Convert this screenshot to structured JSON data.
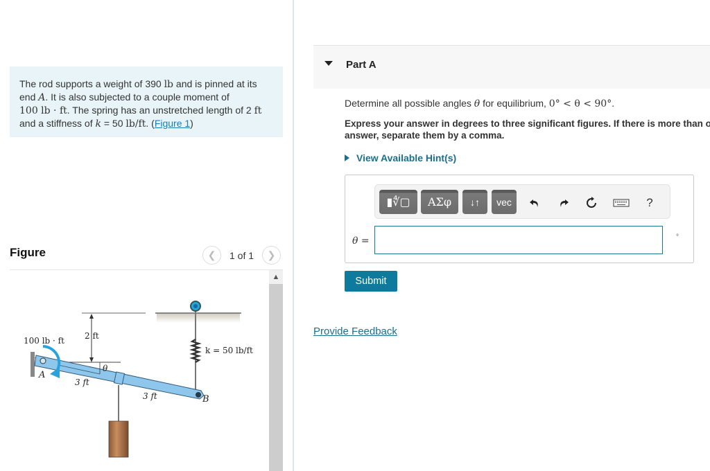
{
  "problem": {
    "text_1": "The rod supports a weight of 390 ",
    "unit_lb": "lb",
    "text_2": " and is pinned at its end ",
    "point_a": "A",
    "text_3": ". It is also subjected to a couple moment of ",
    "moment_value": "100 lb · ft",
    "text_4": ". The spring has an unstretched length of 2 ",
    "unit_ft": "ft",
    "text_5": " and a stiffness of ",
    "k_var": "k",
    "text_6": " = 50 ",
    "stiffness_unit": "lb/ft",
    "text_7": ". (",
    "figure_link": "Figure 1",
    "text_8": ")"
  },
  "figure": {
    "title": "Figure",
    "pager_text": "1 of 1",
    "prev_icon": "chevron-left-icon",
    "next_icon": "chevron-right-icon",
    "labels": {
      "moment": "100 lb · ft",
      "height": "2 ft",
      "theta": "θ",
      "point_a": "A",
      "point_b": "B",
      "seg1": "3 ft",
      "seg2": "3 ft",
      "spring": "k = 50 lb/ft"
    },
    "colors": {
      "rod": "#8fc6ec",
      "moment_arrow": "#2aa3dc",
      "weight": "#b87a4e"
    }
  },
  "part": {
    "title": "Part A",
    "question_prefix": "Determine all possible angles ",
    "theta": "θ",
    "question_mid": " for equilibrium, ",
    "range": "0° < θ < 90°",
    "question_end": ".",
    "instructions": "Express your answer in degrees to three significant figures. If there is more than one answer, separate them by a comma.",
    "hints_label": "View Available Hint(s)"
  },
  "answer": {
    "toolbar": {
      "templates_label": "▮∜▢",
      "greek_label": "ΑΣφ",
      "arrows_label": "↓↑",
      "vec_label": "vec",
      "undo_icon": "undo-icon",
      "redo_icon": "redo-icon",
      "reset_icon": "reset-icon",
      "keyboard_icon": "keyboard-icon",
      "help_label": "?"
    },
    "variable_label": "θ =",
    "input_value": "",
    "unit_label": "°"
  },
  "submit_label": "Submit",
  "feedback_label": "Provide Feedback",
  "colors": {
    "accent": "#0f7b9c",
    "link": "#1a6f8f",
    "problem_bg": "#e8f4f7"
  }
}
